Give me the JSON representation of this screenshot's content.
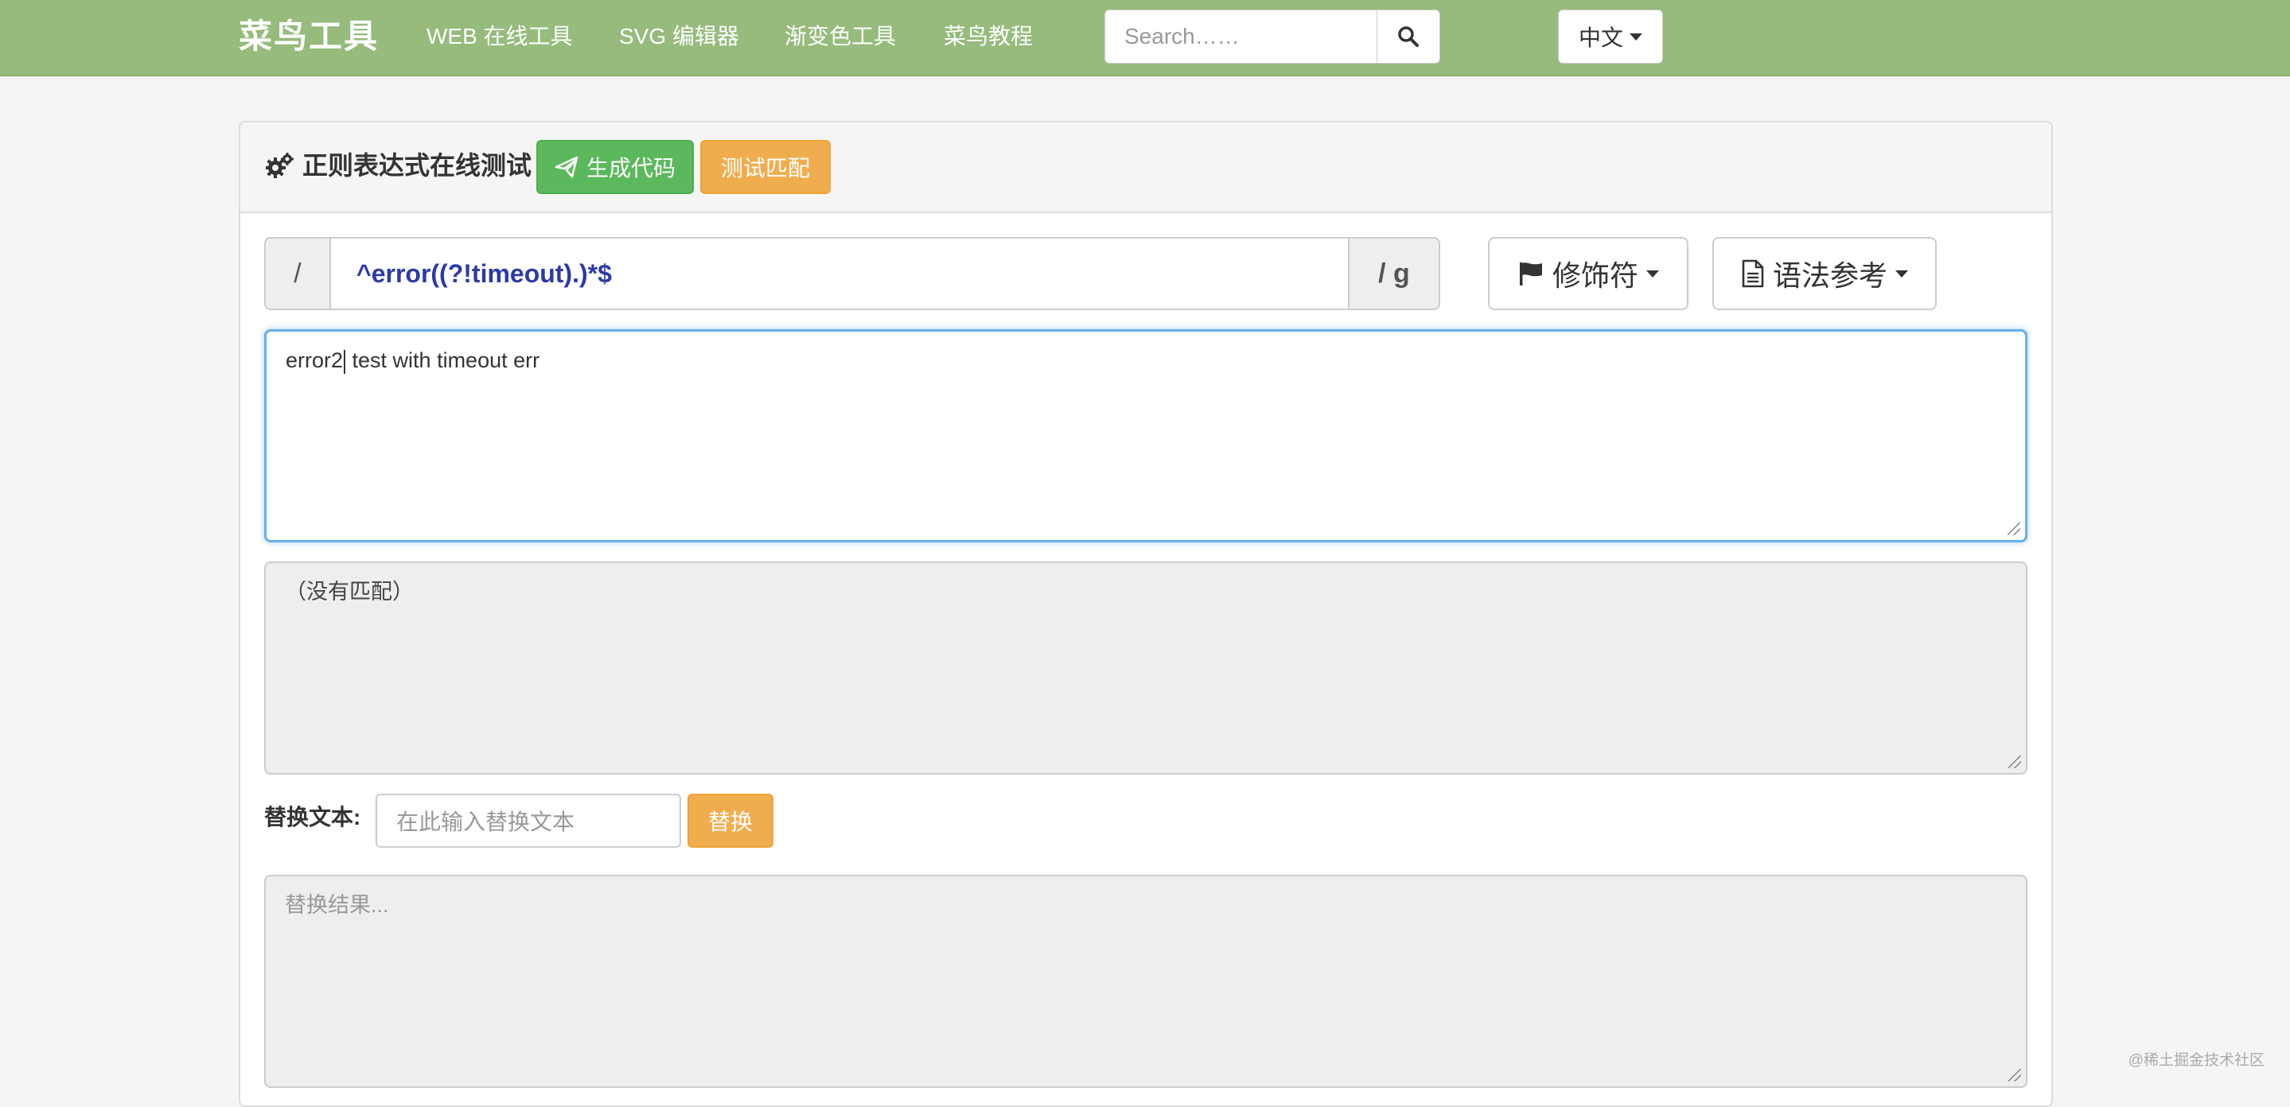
{
  "navbar": {
    "brand": "菜鸟工具",
    "links": [
      "WEB 在线工具",
      "SVG 编辑器",
      "渐变色工具",
      "菜鸟教程"
    ],
    "search_placeholder": "Search……",
    "language": "中文"
  },
  "panel": {
    "title": "正则表达式在线测试",
    "generate_code_label": "生成代码",
    "test_match_label": "测试匹配"
  },
  "regex": {
    "left_delimiter": "/",
    "pattern": "^error((?!timeout).)*$",
    "right_delimiter": "/ g",
    "modifiers_label": "修饰符",
    "syntax_label": "语法参考"
  },
  "test_text": {
    "before_cursor": "error2",
    "after_cursor": " test with timeout err"
  },
  "match_result": "（没有匹配）",
  "replace": {
    "label": "替换文本:",
    "placeholder": "在此输入替换文本",
    "button_label": "替换",
    "result_placeholder": "替换结果..."
  },
  "watermark": "@稀土掘金技术社区",
  "colors": {
    "navbar": "#96bb7c",
    "success": "#5cb85c",
    "warning": "#f0ad4e",
    "regex_text": "#2c3aa8",
    "focus_border": "#66afe9"
  }
}
